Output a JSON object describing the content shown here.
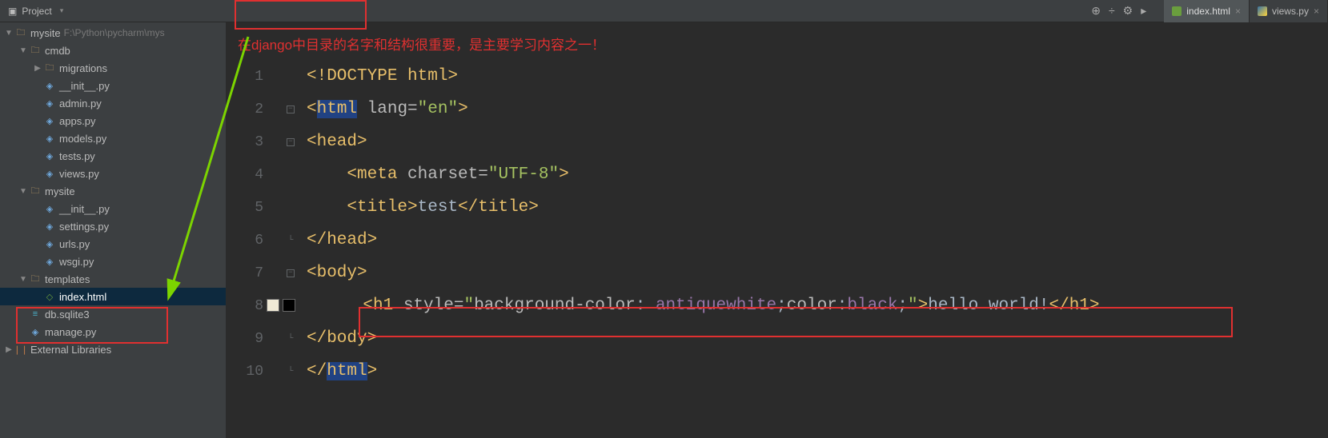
{
  "project_panel_label": "Project",
  "project_root": {
    "name": "mysite",
    "path": "F:\\Python\\pycharm\\mys"
  },
  "tree": [
    {
      "indent": 0,
      "arrow": "open",
      "icon": "folder",
      "label": "mysite",
      "path": "F:\\Python\\pycharm\\mys"
    },
    {
      "indent": 1,
      "arrow": "open",
      "icon": "folder",
      "label": "cmdb"
    },
    {
      "indent": 2,
      "arrow": "closed",
      "icon": "folder",
      "label": "migrations"
    },
    {
      "indent": 2,
      "arrow": "none",
      "icon": "py",
      "label": "__init__.py"
    },
    {
      "indent": 2,
      "arrow": "none",
      "icon": "py",
      "label": "admin.py"
    },
    {
      "indent": 2,
      "arrow": "none",
      "icon": "py",
      "label": "apps.py"
    },
    {
      "indent": 2,
      "arrow": "none",
      "icon": "py",
      "label": "models.py"
    },
    {
      "indent": 2,
      "arrow": "none",
      "icon": "py",
      "label": "tests.py"
    },
    {
      "indent": 2,
      "arrow": "none",
      "icon": "py",
      "label": "views.py"
    },
    {
      "indent": 1,
      "arrow": "open",
      "icon": "folder",
      "label": "mysite"
    },
    {
      "indent": 2,
      "arrow": "none",
      "icon": "py",
      "label": "__init__.py"
    },
    {
      "indent": 2,
      "arrow": "none",
      "icon": "py",
      "label": "settings.py"
    },
    {
      "indent": 2,
      "arrow": "none",
      "icon": "py",
      "label": "urls.py"
    },
    {
      "indent": 2,
      "arrow": "none",
      "icon": "py",
      "label": "wsgi.py"
    },
    {
      "indent": 1,
      "arrow": "open",
      "icon": "folder",
      "label": "templates"
    },
    {
      "indent": 2,
      "arrow": "none",
      "icon": "html",
      "label": "index.html",
      "selected": true
    },
    {
      "indent": 1,
      "arrow": "none",
      "icon": "db",
      "label": "db.sqlite3"
    },
    {
      "indent": 1,
      "arrow": "none",
      "icon": "py",
      "label": "manage.py"
    },
    {
      "indent": 0,
      "arrow": "closed",
      "icon": "lib",
      "label": "External Libraries"
    }
  ],
  "tabs": [
    {
      "label": "index.html",
      "icon": "html",
      "active": true
    },
    {
      "label": "views.py",
      "icon": "py",
      "active": false
    }
  ],
  "annotation": "在django中目录的名字和结构很重要，是主要学习内容之一！",
  "code": {
    "1": {
      "fold": "",
      "html": "<span class='doctype'>&lt;!DOCTYPE&nbsp;html&gt;</span>"
    },
    "2": {
      "fold": "minus",
      "html": "<span class='tag-bracket'>&lt;</span><span class='tag-name highlight-2w'>html</span><span class='plain'>&nbsp;</span><span class='attr-name'>lang=</span><span class='attr-val'>\"en\"</span><span class='tag-bracket'>&gt;</span>"
    },
    "3": {
      "fold": "minus",
      "html": "<span class='tag-bracket'>&lt;head&gt;</span>"
    },
    "4": {
      "fold": "",
      "html": "<span class='plain'>&nbsp;&nbsp;&nbsp;&nbsp;</span><span class='tag-bracket'>&lt;meta&nbsp;</span><span class='attr-name'>charset=</span><span class='attr-val'>\"UTF-8\"</span><span class='tag-bracket'>&gt;</span>"
    },
    "5": {
      "fold": "",
      "html": "<span class='plain'>&nbsp;&nbsp;&nbsp;&nbsp;</span><span class='tag-bracket'>&lt;title&gt;</span><span class='plain'>test</span><span class='tag-bracket'>&lt;/title&gt;</span>"
    },
    "6": {
      "fold": "end",
      "html": "<span class='tag-bracket'>&lt;/head&gt;</span>"
    },
    "7": {
      "fold": "minus",
      "html": "<span class='tag-bracket'>&lt;body&gt;</span>"
    },
    "8": {
      "fold": "",
      "gutter_extra": true,
      "html": "<span class='plain'>&nbsp;&nbsp;&nbsp;&nbsp;</span><span class='tag-bracket'>&lt;h1&nbsp;</span><span class='attr-name'>style=</span><span class='attr-val'>\"</span><span class='css-prop'>background-color</span><span class='plain'>:&nbsp;</span><span class='css-val-kw'>antiquewhite</span><span class='plain'>;</span><span class='css-prop'>color</span><span class='plain'>:</span><span class='css-val-kw'>black</span><span class='plain'>;</span><span class='attr-val'>\"</span><span class='tag-bracket'>&gt;</span><span class='plain'>hello&nbsp;world!</span><span class='tag-bracket'>&lt;/h1&gt;</span>"
    },
    "9": {
      "fold": "end",
      "html": "<span class='tag-bracket'>&lt;/body&gt;</span>"
    },
    "10": {
      "fold": "end",
      "html": "<span class='tag-bracket'>&lt;/</span><span class='tag-name highlight-2w'>html</span><span class='tag-bracket'>&gt;</span>"
    }
  },
  "toolbar_icons": [
    "⊕",
    "÷",
    "⚙",
    "▸"
  ]
}
